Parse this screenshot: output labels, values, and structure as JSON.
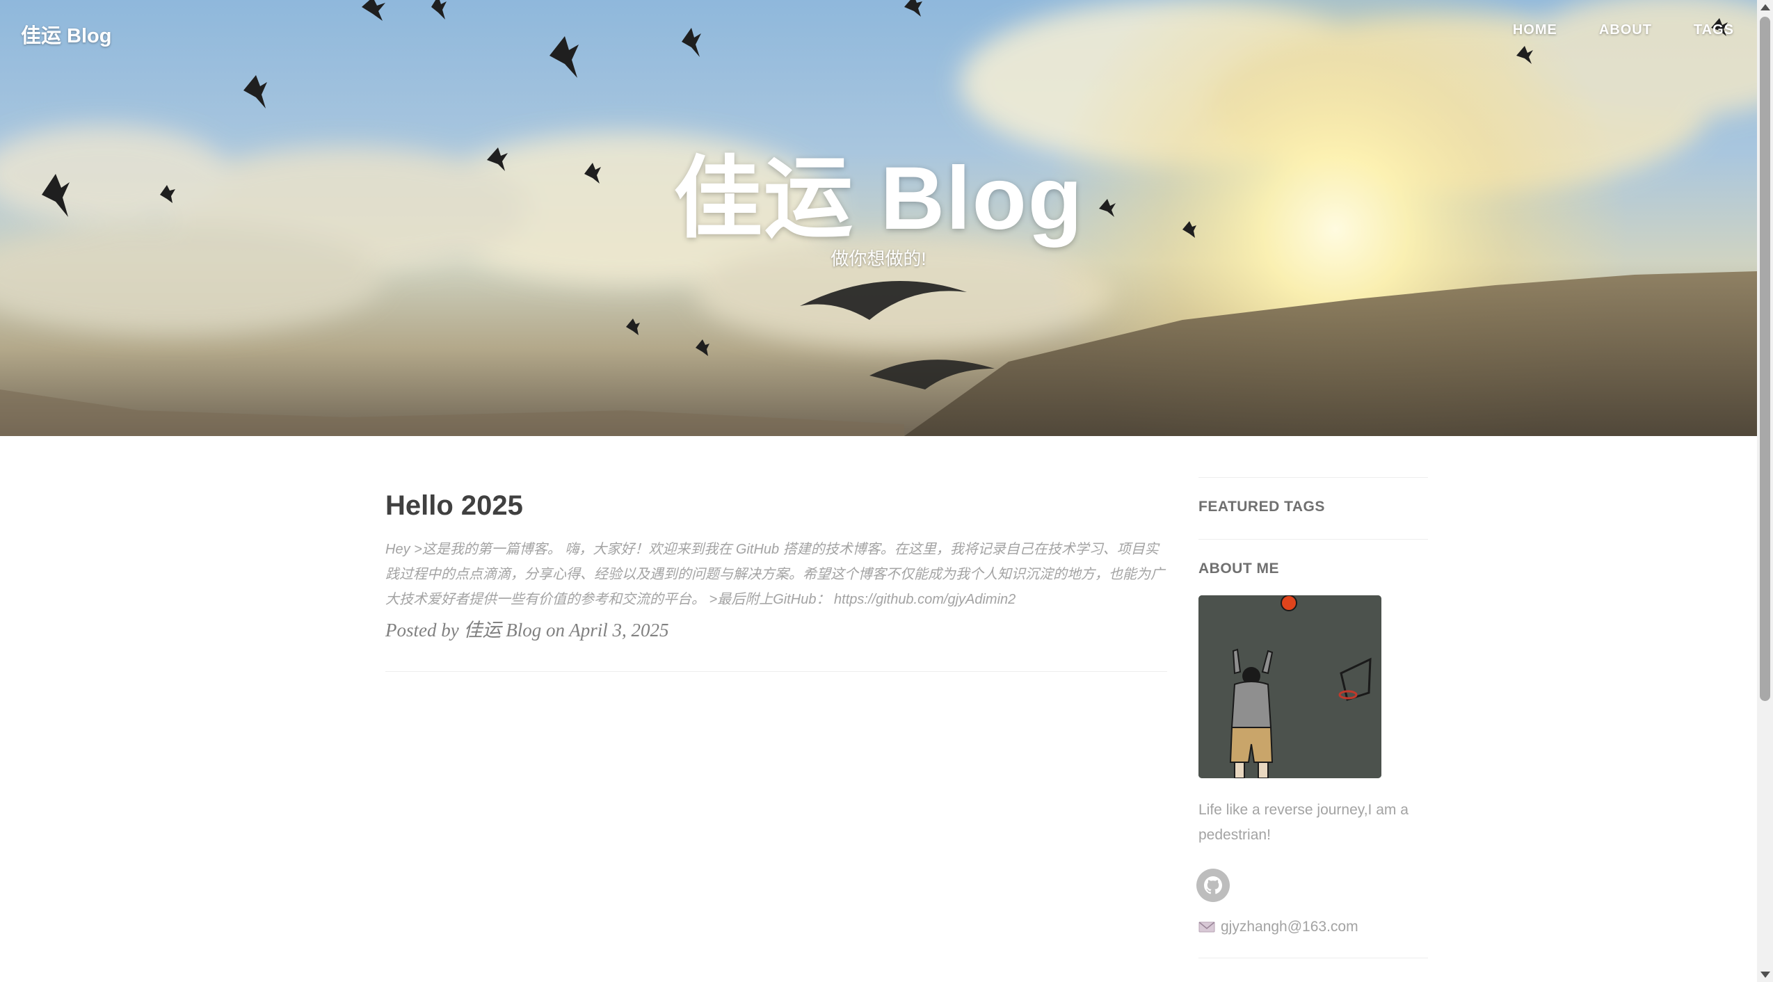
{
  "header": {
    "brand": "佳运 Blog",
    "nav": [
      "HOME",
      "ABOUT",
      "TAGS"
    ],
    "title": "佳运 Blog",
    "subtitle": "做你想做的!"
  },
  "post": {
    "title": "Hello 2025",
    "excerpt": "Hey >这是我的第一篇博客。 嗨，大家好！欢迎来到我在 GitHub 搭建的技术博客。在这里，我将记录自己在技术学习、项目实践过程中的点点滴滴，分享心得、经验以及遇到的问题与解决方案。希望这个博客不仅能成为我个人知识沉淀的地方，也能为广大技术爱好者提供一些有价值的参考和交流的平台。 >最后附上GitHub： https://github.com/gjyAdimin2",
    "meta": "Posted by  佳运 Blog on April 3, 2025"
  },
  "sidebar": {
    "featured_tags_heading": "FEATURED TAGS",
    "about_heading": "ABOUT ME",
    "about_text": "Life like a reverse journey,I am a pedestrian!",
    "email": "gjyzhangh@163.com",
    "icons": [
      "github-icon",
      "mail-icon"
    ]
  },
  "colors": {
    "title_text": "#404040",
    "muted_text": "#a3a3a3",
    "sidebar_heading": "#707070",
    "avatar_bg": "#4c524d"
  }
}
